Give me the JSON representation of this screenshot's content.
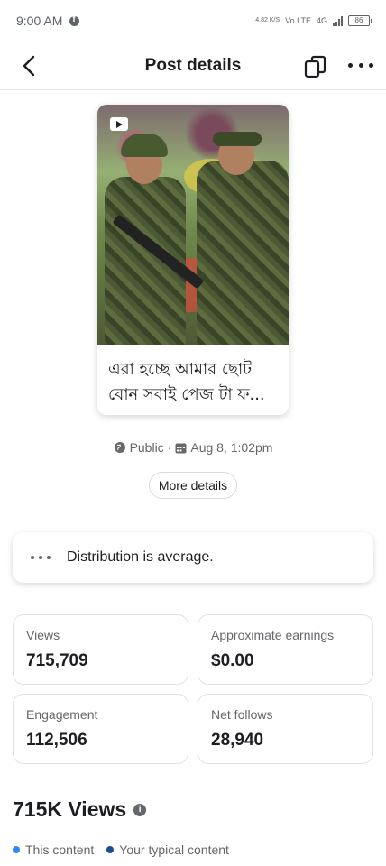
{
  "status_bar": {
    "time": "9:00 AM",
    "net_speed": "4.82 K/S",
    "network": "Vo LTE",
    "signal_label": "4G",
    "battery": "86"
  },
  "app_bar": {
    "title": "Post details",
    "back_icon": "arrow-left-icon",
    "copy_icon": "copy-icon",
    "more_icon": "more-horizontal-icon"
  },
  "post": {
    "media_badge_icon": "video-icon",
    "caption": "এরা হচ্ছে আমার ছোট বোন  সবাই পেজ টা ফ..."
  },
  "meta": {
    "audience": "Public",
    "separator": "·",
    "date": "Aug 8, 1:02pm"
  },
  "more_details_label": "More details",
  "distribution": {
    "text": "Distribution is average."
  },
  "stats": [
    {
      "label": "Views",
      "value": "715,709"
    },
    {
      "label": "Approximate earnings",
      "value": "$0.00"
    },
    {
      "label": "Engagement",
      "value": "112,506"
    },
    {
      "label": "Net follows",
      "value": "28,940"
    }
  ],
  "views_section": {
    "title": "715K Views",
    "legend": [
      {
        "label": "This content",
        "color": "#2d88ff"
      },
      {
        "label": "Your typical content",
        "color": "#1a4f8f"
      }
    ]
  },
  "colors": {
    "text_primary": "#1c1e21",
    "text_secondary": "#65676b",
    "this_content": "#2d88ff",
    "typical_content": "#1a4f8f"
  }
}
